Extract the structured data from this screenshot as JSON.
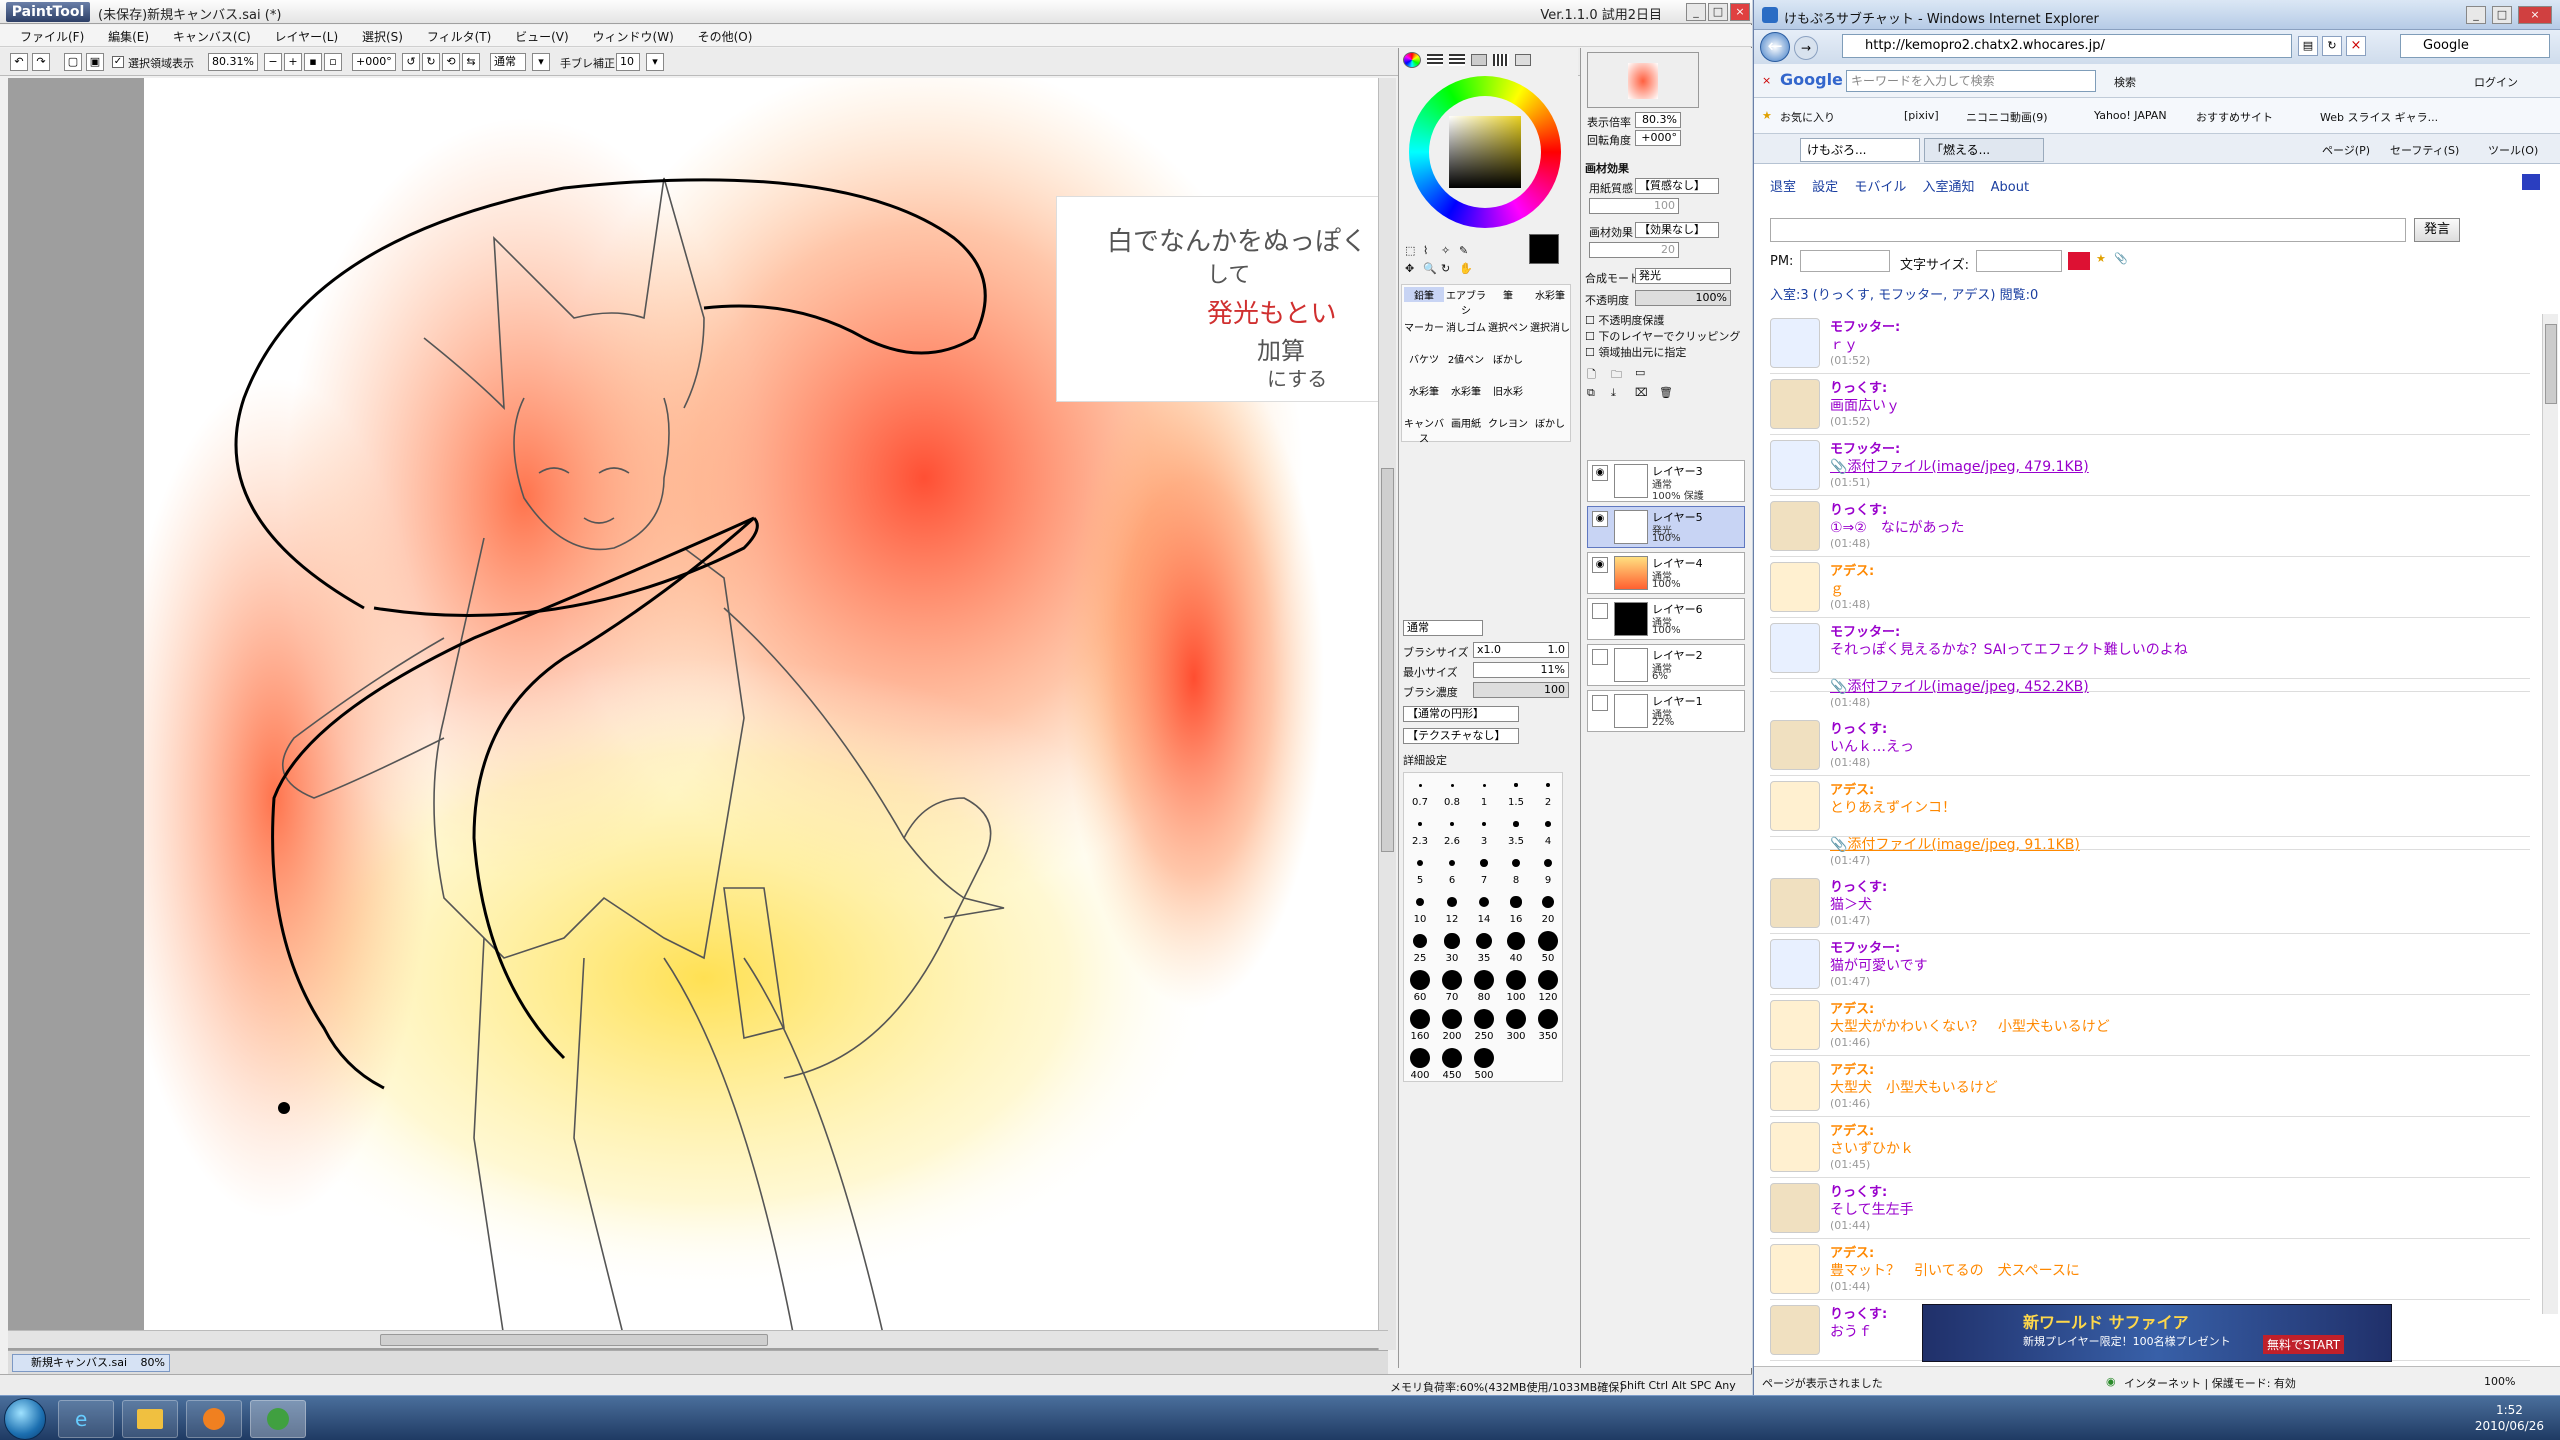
{
  "sai": {
    "title": "(未保存)新規キャンバス.sai (*)",
    "logo": "PaintTool SAI",
    "version": "Ver.1.1.0 試用2日目",
    "menu": [
      "ファイル(F)",
      "編集(E)",
      "キャンバス(C)",
      "レイヤー(L)",
      "選択(S)",
      "フィルタ(T)",
      "ビュー(V)",
      "ウィンドウ(W)",
      "その他(O)"
    ],
    "toolbar": {
      "selection_display": "選択領域表示",
      "zoom": "80.31%",
      "rotation": "+000°",
      "blend": "通常",
      "stabilizer_label": "手ブレ補正",
      "stabilizer": "10"
    },
    "canvas_tab": "新規キャンバス.sai",
    "canvas_tab_zoom": "80%",
    "note": {
      "line1": "白でなんかをぬっぽく",
      "line2": "して",
      "line3": "発光もとい",
      "line4": "加算",
      "line5": "にする"
    },
    "status": {
      "memory": "メモリ負荷率:60%(432MB使用/1033MB確保)",
      "keys": "Shift Ctrl Alt SPC Any"
    },
    "brush": {
      "tools": [
        "鉛筆",
        "エアブラシ",
        "筆",
        "水彩筆",
        "マーカー",
        "消しゴム",
        "選択ペン",
        "選択消し",
        "バケツ",
        "2値ペン",
        "ぼかし",
        "水彩筆",
        "水彩筆",
        "旧水彩",
        "キャンバス",
        "画用紙",
        "クレヨン",
        "ぼかし"
      ],
      "mode": "通常",
      "size_label": "ブラシサイズ",
      "size_mult": "x1.0",
      "size": "1.0",
      "min_label": "最小サイズ",
      "min": "11%",
      "density_label": "ブラシ濃度",
      "density": "100",
      "shape": "【通常の円形】",
      "texture": "【テクスチャなし】",
      "detail": "詳細設定",
      "sizes": [
        "0.7",
        "0.8",
        "1",
        "1.5",
        "2",
        "2.3",
        "2.6",
        "3",
        "3.5",
        "4",
        "5",
        "6",
        "7",
        "8",
        "9",
        "10",
        "12",
        "14",
        "16",
        "20",
        "25",
        "30",
        "35",
        "40",
        "50",
        "60",
        "70",
        "80",
        "100",
        "120",
        "160",
        "200",
        "250",
        "300",
        "350",
        "400",
        "450",
        "500"
      ]
    },
    "nav": {
      "zoom_label": "表示倍率",
      "zoom": "80.3%",
      "angle_label": "回転角度",
      "angle": "+000°"
    },
    "effects": {
      "header": "画材効果",
      "paper_label": "用紙質感",
      "paper": "【質感なし】",
      "paper_val": "100",
      "effect_label": "画材効果",
      "effect": "【効果なし】",
      "effect_val": "20"
    },
    "blendmode": {
      "label": "合成モード",
      "value": "発光",
      "opacity_label": "不透明度",
      "opacity": "100%"
    },
    "checks": [
      "不透明度保護",
      "下のレイヤーでクリッピング",
      "領域抽出元に指定"
    ],
    "layers": [
      {
        "name": "レイヤー3",
        "mode": "通常",
        "op": "100% 保護"
      },
      {
        "name": "レイヤー5",
        "mode": "発光",
        "op": "100%"
      },
      {
        "name": "レイヤー4",
        "mode": "通常",
        "op": "100%"
      },
      {
        "name": "レイヤー6",
        "mode": "通常",
        "op": "100%"
      },
      {
        "name": "レイヤー2",
        "mode": "通常",
        "op": "6%"
      },
      {
        "name": "レイヤー1",
        "mode": "通常",
        "op": "22%"
      }
    ]
  },
  "ie": {
    "title": "けもぷろサブチャット - Windows Internet Explorer",
    "url": "http://kemopro2.chatx2.whocares.jp/",
    "search": "Google",
    "google_placeholder": "キーワードを入力して検索",
    "search_btn": "検索",
    "login": "ログイン",
    "favorites": [
      "お気に入り",
      "[pixiv]",
      "ニコニコ動画(9)",
      "Yahoo! JAPAN",
      "おすすめサイト",
      "Web スライス ギャラ..."
    ],
    "tabs": [
      "けもぷろ...",
      "「燃える..."
    ],
    "menus": [
      "ページ(P)",
      "セーフティ(S)",
      "ツール(O)"
    ],
    "status": "ページが表示されました",
    "zone": "インターネット | 保護モード: 有効",
    "zoom": "100%"
  },
  "chat": {
    "links": [
      "退室",
      "設定",
      "モバイル",
      "入室通知",
      "About"
    ],
    "send": "発言",
    "pm_label": "PM:",
    "fontsize_label": "文字サイズ:",
    "room_info": "入室:3 (りっくす, モフッター, アデス) 閲覧:0",
    "messages": [
      {
        "name": "モフッター:",
        "text": "ｒｙ",
        "time": "(01:52)",
        "who": "m"
      },
      {
        "name": "りっくす:",
        "text": "画面広いｙ",
        "time": "(01:52)",
        "who": "r"
      },
      {
        "name": "モフッター:",
        "text": "📎添付ファイル(image/jpeg, 479.1KB)",
        "time": "(01:51)",
        "who": "m"
      },
      {
        "name": "りっくす:",
        "text": "①⇒②　なにがあった",
        "time": "(01:48)",
        "who": "r"
      },
      {
        "name": "アデス:",
        "text": "ｇ",
        "time": "(01:48)",
        "who": "a"
      },
      {
        "name": "モフッター:",
        "text": "それっぽく見えるかな？SAIってエフェクト難しいのよね",
        "time": "",
        "who": "m"
      },
      {
        "name": "",
        "text": "📎添付ファイル(image/jpeg, 452.2KB)",
        "time": "(01:48)",
        "who": "m"
      },
      {
        "name": "りっくす:",
        "text": "いんｋ…えっ",
        "time": "(01:48)",
        "who": "r"
      },
      {
        "name": "アデス:",
        "text": "とりあえずインコ！",
        "time": "",
        "who": "a"
      },
      {
        "name": "",
        "text": "📎添付ファイル(image/jpeg, 91.1KB)",
        "time": "(01:47)",
        "who": "a"
      },
      {
        "name": "りっくす:",
        "text": "猫＞犬",
        "time": "(01:47)",
        "who": "r"
      },
      {
        "name": "モフッター:",
        "text": "猫が可愛いです",
        "time": "(01:47)",
        "who": "m"
      },
      {
        "name": "アデス:",
        "text": "大型犬がかわいくない？　小型犬もいるけど",
        "time": "(01:46)",
        "who": "a"
      },
      {
        "name": "アデス:",
        "text": "大型犬　小型犬もいるけど",
        "time": "(01:46)",
        "who": "a"
      },
      {
        "name": "アデス:",
        "text": "さいずひかｋ",
        "time": "(01:45)",
        "who": "a"
      },
      {
        "name": "りっくす:",
        "text": "そして生左手",
        "time": "(01:44)",
        "who": "r"
      },
      {
        "name": "アデス:",
        "text": "豊マット？　引いてるの　犬スペースに",
        "time": "(01:44)",
        "who": "a"
      },
      {
        "name": "りっくす:",
        "text": "おうｆ",
        "time": "",
        "who": "r"
      }
    ],
    "banner": {
      "line1": "新ワールド サファイア",
      "line2": "新規プレイヤー限定！100名様プレゼント",
      "line3": "無料でSTART"
    }
  },
  "clock": {
    "time": "1:52",
    "date": "2010/06/26"
  },
  "colors": {
    "moffutter": "#9900cc",
    "rixx": "#9900cc",
    "ades": "#ff8800",
    "sel_layer": "#c8d4f4"
  }
}
